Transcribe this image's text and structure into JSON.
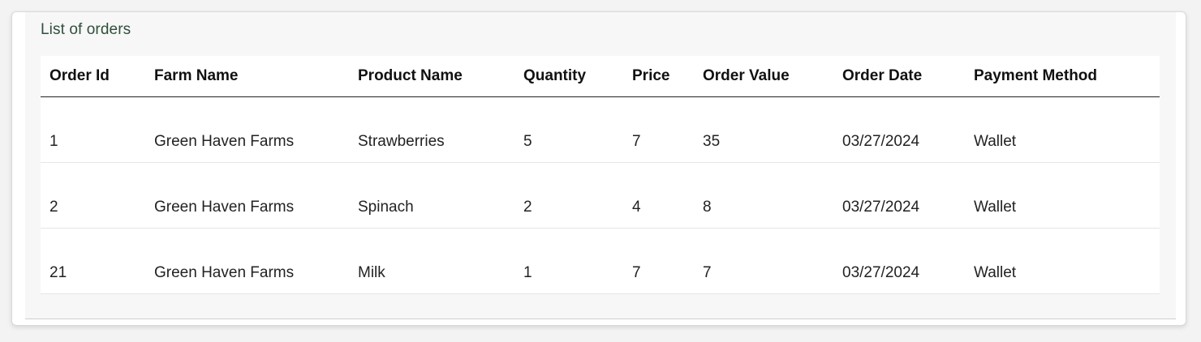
{
  "panel": {
    "title": "List of orders"
  },
  "table": {
    "headers": [
      "Order Id",
      "Farm Name",
      "Product Name",
      "Quantity",
      "Price",
      "Order Value",
      "Order Date",
      "Payment Method"
    ],
    "rows": [
      [
        "1",
        "Green Haven Farms",
        "Strawberries",
        "5",
        "7",
        "35",
        "03/27/2024",
        "Wallet"
      ],
      [
        "2",
        "Green Haven Farms",
        "Spinach",
        "2",
        "4",
        "8",
        "03/27/2024",
        "Wallet"
      ],
      [
        "21",
        "Green Haven Farms",
        "Milk",
        "1",
        "7",
        "7",
        "03/27/2024",
        "Wallet"
      ]
    ]
  },
  "colors": {
    "title": "#2f4f3a",
    "panel_bg": "#f7f7f7",
    "header_rule": "#222222"
  }
}
